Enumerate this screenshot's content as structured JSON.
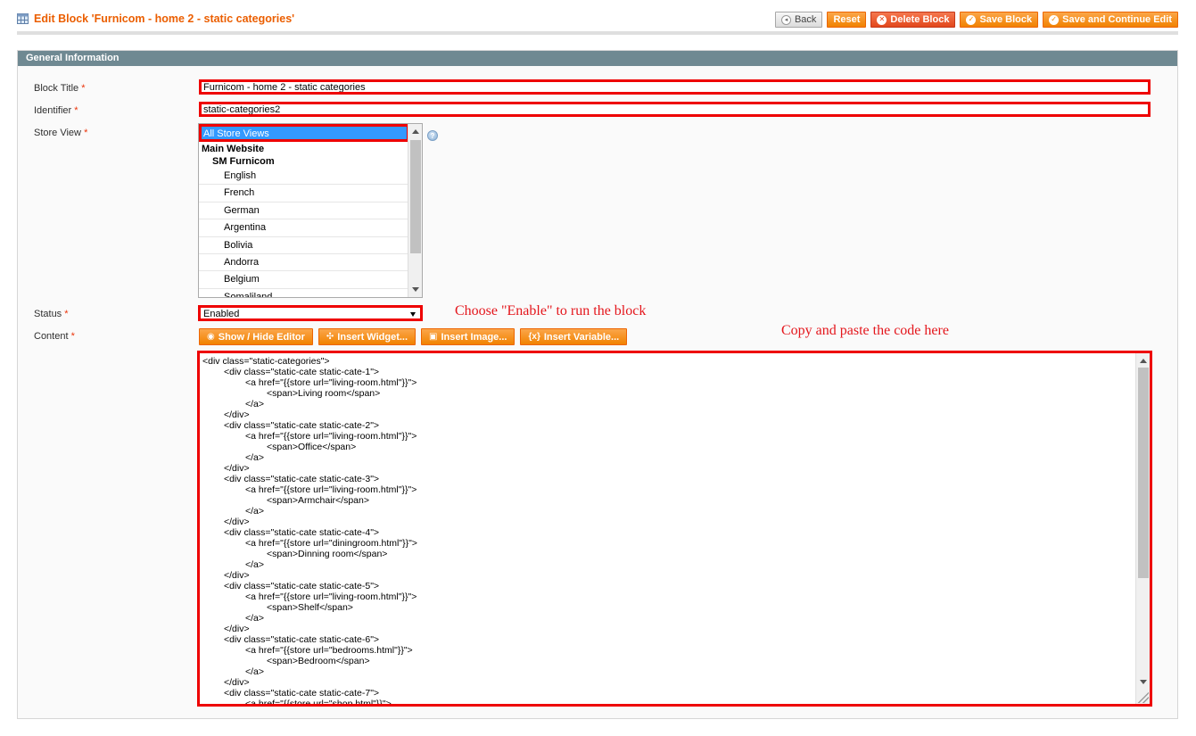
{
  "header": {
    "title": "Edit Block 'Furnicom - home 2 - static categories'",
    "title_icon": "grid-icon",
    "accent_color": "#eb5e00",
    "buttons": {
      "back": "Back",
      "reset": "Reset",
      "delete": "Delete Block",
      "save": "Save Block",
      "save_continue": "Save and Continue Edit"
    }
  },
  "fieldset": {
    "legend": "General Information",
    "fields": {
      "block_title": {
        "label": "Block Title",
        "required": "*",
        "value": "Furnicom - home 2 - static categories"
      },
      "identifier": {
        "label": "Identifier",
        "required": "*",
        "value": "static-categories2"
      },
      "store_view": {
        "label": "Store View",
        "required": "*",
        "options": {
          "selected": "All Store Views",
          "website": "Main Website",
          "store": "SM Furnicom",
          "views": [
            "English",
            "French",
            "German",
            "Argentina",
            "Bolivia",
            "Andorra",
            "Belgium",
            "Somaliland"
          ]
        }
      },
      "status": {
        "label": "Status",
        "required": "*",
        "value": "Enabled"
      },
      "content": {
        "label": "Content",
        "required": "*",
        "buttons": {
          "show_hide": "Show / Hide Editor",
          "insert_widget": "Insert Widget...",
          "insert_image": "Insert Image...",
          "insert_variable": "Insert Variable..."
        },
        "code": "<div class=\"static-categories\">\n\t<div class=\"static-cate static-cate-1\">\n\t\t<a href=\"{{store url=\"living-room.html\"}}\">\n\t\t\t<span>Living room</span>\n\t\t</a>\n\t</div>\n\t<div class=\"static-cate static-cate-2\">\n\t\t<a href=\"{{store url=\"living-room.html\"}}\">\n\t\t\t<span>Office</span>\n\t\t</a>\n\t</div>\n\t<div class=\"static-cate static-cate-3\">\n\t\t<a href=\"{{store url=\"living-room.html\"}}\">\n\t\t\t<span>Armchair</span>\n\t\t</a>\n\t</div>\n\t<div class=\"static-cate static-cate-4\">\n\t\t<a href=\"{{store url=\"diningroom.html\"}}\">\n\t\t\t<span>Dinning room</span>\n\t\t</a>\n\t</div>\n\t<div class=\"static-cate static-cate-5\">\n\t\t<a href=\"{{store url=\"living-room.html\"}}\">\n\t\t\t<span>Shelf</span>\n\t\t</a>\n\t</div>\n\t<div class=\"static-cate static-cate-6\">\n\t\t<a href=\"{{store url=\"bedrooms.html\"}}\">\n\t\t\t<span>Bedroom</span>\n\t\t</a>\n\t</div>\n\t<div class=\"static-cate static-cate-7\">\n\t\t<a href=\"{{store url=\"shop.html\"}}\">"
      }
    }
  },
  "annotations": {
    "status_note": "Choose \"Enable\" to run the block",
    "content_note": "Copy and paste the code here",
    "color": "#e4161c"
  }
}
